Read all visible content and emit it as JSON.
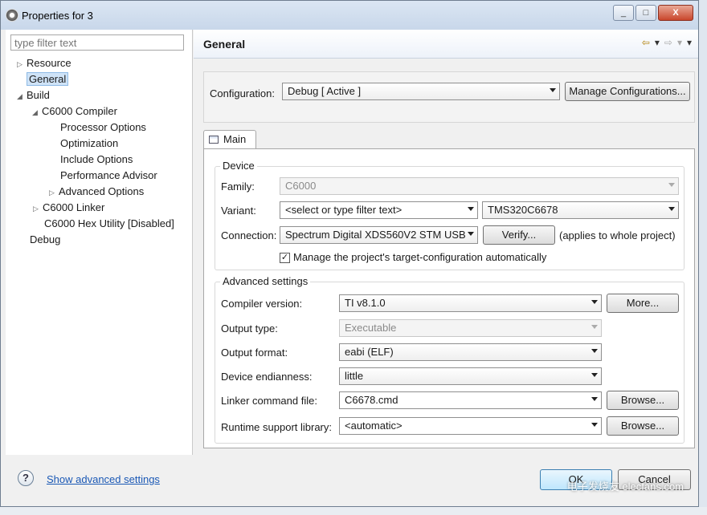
{
  "window": {
    "title": "Properties for 3",
    "close_glyph": "X",
    "minimize_glyph": "_",
    "maximize_glyph": "□"
  },
  "left": {
    "filter_placeholder": "type filter text",
    "tree": [
      {
        "label": "Resource",
        "arrow": "▷"
      },
      {
        "label": "General",
        "arrow": "",
        "selected": true
      },
      {
        "label": "Build",
        "arrow": "◢"
      },
      {
        "label": "C6000 Compiler",
        "arrow": "◢"
      },
      {
        "label": "Processor Options",
        "arrow": ""
      },
      {
        "label": "Optimization",
        "arrow": ""
      },
      {
        "label": "Include Options",
        "arrow": ""
      },
      {
        "label": "Performance Advisor",
        "arrow": ""
      },
      {
        "label": "Advanced Options",
        "arrow": "▷"
      },
      {
        "label": "C6000 Linker",
        "arrow": "▷"
      },
      {
        "label": "C6000 Hex Utility  [Disabled]",
        "arrow": ""
      },
      {
        "label": "Debug",
        "arrow": ""
      }
    ]
  },
  "header": {
    "title": "General"
  },
  "configuration": {
    "label": "Configuration:",
    "value": "Debug  [ Active ]",
    "manage_label": "Manage Configurations..."
  },
  "tab": {
    "label": "Main"
  },
  "device": {
    "title": "Device",
    "family_label": "Family:",
    "family_value": "C6000",
    "variant_label": "Variant:",
    "variant_filter": "<select or type filter text>",
    "variant_value": "TMS320C6678",
    "connection_label": "Connection:",
    "connection_value": "Spectrum Digital XDS560V2 STM USB",
    "verify_label": "Verify...",
    "applies_note": "(applies to whole project)",
    "manage_checkbox_label": "Manage the project's target-configuration automatically",
    "manage_checked": true
  },
  "advanced": {
    "title": "Advanced settings",
    "compiler_label": "Compiler version:",
    "compiler_value": "TI v8.1.0",
    "more_label": "More...",
    "output_type_label": "Output type:",
    "output_type_value": "Executable",
    "output_format_label": "Output format:",
    "output_format_value": "eabi (ELF)",
    "endianness_label": "Device endianness:",
    "endianness_value": "little",
    "linker_label": "Linker command file:",
    "linker_value": "C6678.cmd",
    "browse_label": "Browse...",
    "runtime_label": "Runtime support library:",
    "runtime_value": "<automatic>",
    "browse2_label": "Browse..."
  },
  "footer": {
    "help_glyph": "?",
    "advanced_link": "Show advanced settings",
    "ok_label": "OK",
    "cancel_label": "Cancel",
    "watermark": "电子发烧友 elecfans.com"
  }
}
